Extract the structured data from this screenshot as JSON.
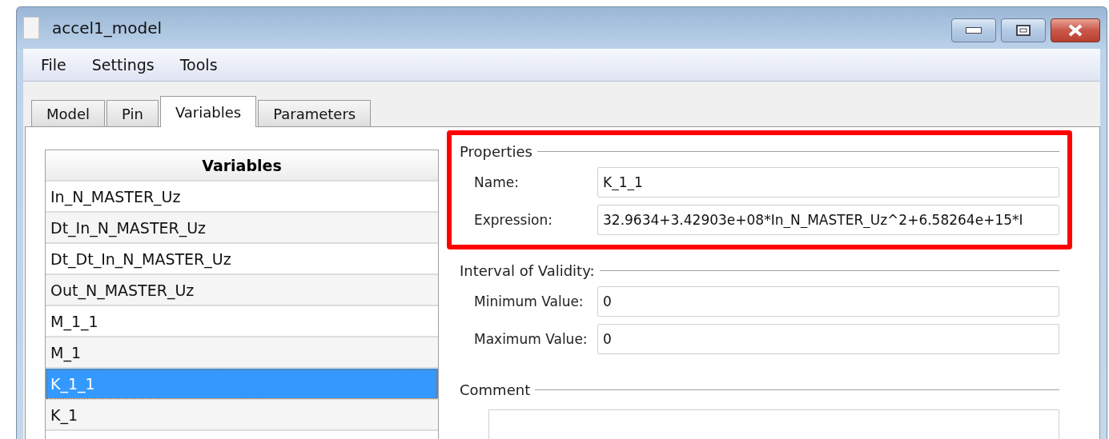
{
  "window": {
    "title": "accel1_model"
  },
  "menu": [
    "File",
    "Settings",
    "Tools"
  ],
  "tabs": [
    {
      "label": "Model",
      "selected": false
    },
    {
      "label": "Pin",
      "selected": false
    },
    {
      "label": "Variables",
      "selected": true
    },
    {
      "label": "Parameters",
      "selected": false
    }
  ],
  "variables": {
    "header": "Variables",
    "rows": [
      {
        "name": "In_N_MASTER_Uz",
        "selected": false
      },
      {
        "name": "Dt_In_N_MASTER_Uz",
        "selected": false
      },
      {
        "name": "Dt_Dt_In_N_MASTER_Uz",
        "selected": false
      },
      {
        "name": "Out_N_MASTER_Uz",
        "selected": false
      },
      {
        "name": "M_1_1",
        "selected": false
      },
      {
        "name": "M_1",
        "selected": false
      },
      {
        "name": "K_1_1",
        "selected": true
      },
      {
        "name": "K_1",
        "selected": false
      }
    ]
  },
  "properties": {
    "title": "Properties",
    "highlighted": true,
    "fields": [
      {
        "label": "Name:",
        "value": "K_1_1"
      },
      {
        "label": "Expression:",
        "value": "32.9634+3.42903e+08*In_N_MASTER_Uz^2+6.58264e+15*I"
      }
    ]
  },
  "validity": {
    "title": "Interval of Validity:",
    "fields": [
      {
        "label": "Minimum Value:",
        "value": "0"
      },
      {
        "label": "Maximum Value:",
        "value": "0"
      }
    ]
  },
  "comment": {
    "title": "Comment"
  }
}
